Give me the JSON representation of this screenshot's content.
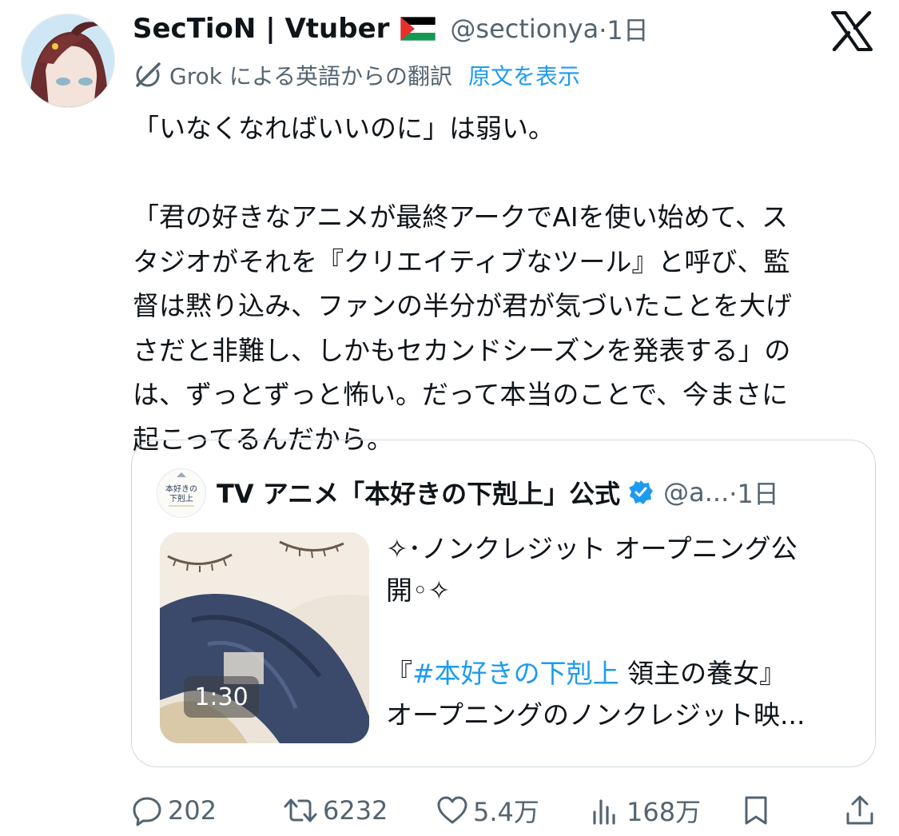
{
  "author": {
    "display_name": "SecTioN | Vtuber",
    "handle": "@sectionya",
    "time": "·1日",
    "flag_icon": "palestine-flag-icon"
  },
  "translation": {
    "label": "Grok による英語からの翻訳",
    "show_original": "原文を表示"
  },
  "tweet": {
    "paragraph1": "「いなくなればいいのに」は弱い。",
    "paragraph2_lines": [
      "「君の好きなアニメが最終アークでAIを使い始めて、ス",
      "タジオがそれを『クリエイティブなツール』と呼び、監",
      "督は黙り込み、ファンの半分が君が気づいたことを大げ",
      "さだと非難し、しかもセカンドシーズンを発表する」の",
      "は、ずっとずっと怖い。だって本当のことで、今まさに",
      "起こってるんだから。"
    ]
  },
  "quote": {
    "display_name": "TV アニメ「本好きの下剋上」公式",
    "handle": "@a...",
    "time": "·1日",
    "avatar_lines": [
      "本好きの",
      "下剋上"
    ],
    "video_duration": "1:30",
    "line1": "✧･ノンクレジット オープニング公",
    "line2": "開◦✧",
    "line3_hashtag": "#本好きの下剋上",
    "line3_open": "『",
    "line3_rest": " 領主の養女』",
    "line4": "オープニングのノンクレジット映..."
  },
  "actions": {
    "replies": "202",
    "retweets": "6232",
    "likes": "5.4万",
    "views": "168万"
  },
  "colors": {
    "accent": "#1d9bf0",
    "secondary_text": "#536471",
    "border": "#cfd9de"
  }
}
